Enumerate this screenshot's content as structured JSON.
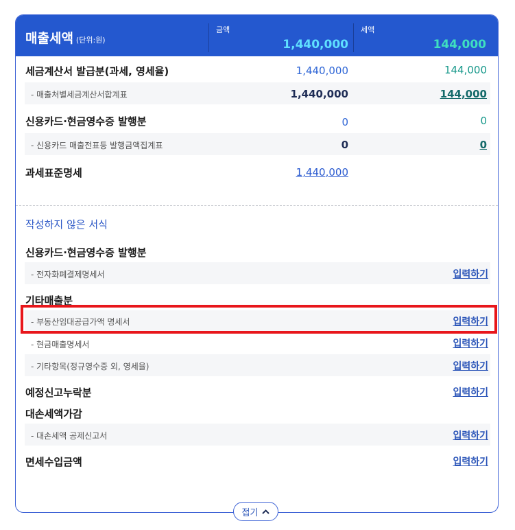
{
  "header": {
    "title": "매출세액",
    "unit": "(단위:원)",
    "amount_label": "금액",
    "amount_value": "1,440,000",
    "tax_label": "세액",
    "tax_value": "144,000"
  },
  "rows": [
    {
      "label": "세금계산서 발급분(과세, 영세율)",
      "amount": "1,440,000",
      "tax": "144,000"
    },
    {
      "label": "- 매출처별세금계산서합계표",
      "amount": "1,440,000",
      "tax": "144,000"
    },
    {
      "label": "신용카드·현금영수증 발행분",
      "amount": "0",
      "tax": "0"
    },
    {
      "label": "- 신용카드 매출전표등 발행금액집계표",
      "amount": "0",
      "tax": "0"
    },
    {
      "label": "과세표준명세",
      "amount": "1,440,000"
    }
  ],
  "unwritten": {
    "title": "작성하지 않은 서식",
    "link_label": "입력하기",
    "items": [
      "신용카드·현금영수증 발행분",
      "- 전자화폐결제명세서",
      "기타매출분",
      "- 부동산임대공급가액 명세서",
      "- 현금매출명세서",
      "- 기타항목(정규영수증 외, 영세율)",
      "예정신고누락분",
      "대손세액가감",
      "- 대손세액 공제신고서",
      "면세수입금액"
    ]
  },
  "fold_button": {
    "label": "접기",
    "icon": "chevron-up-icon"
  },
  "colors": {
    "header_bg": "#2458cf",
    "amount_header": "#5fe0ff",
    "tax_header": "#3fe0c0",
    "highlight": "#e8161b"
  }
}
